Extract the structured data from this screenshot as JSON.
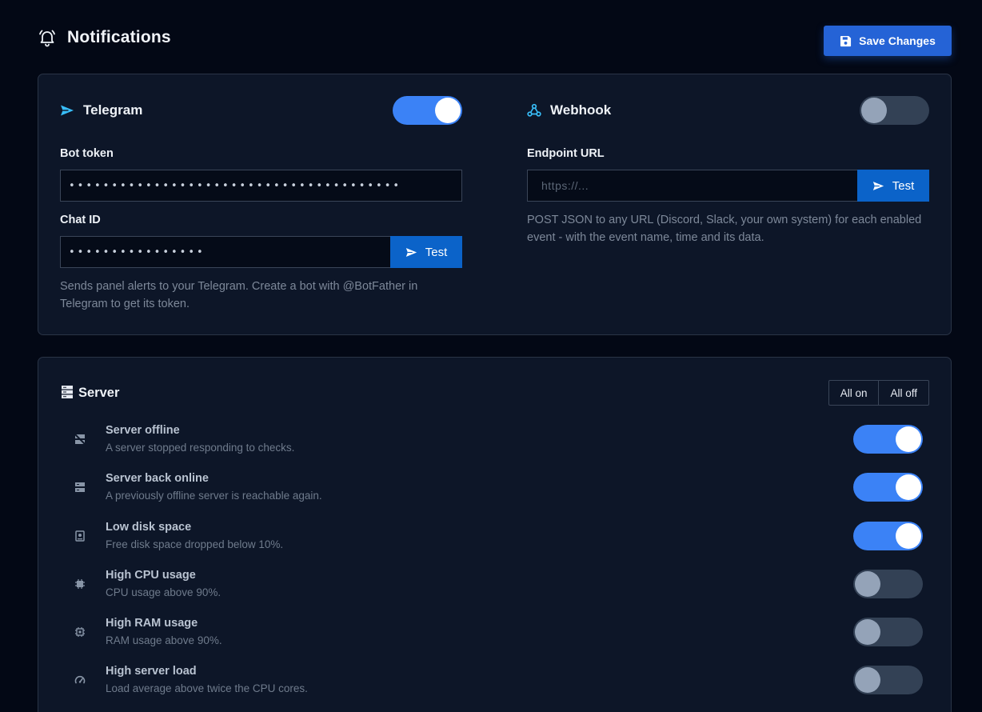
{
  "header": {
    "title": "Notifications",
    "title_icon": "bell-icon",
    "save_label": "Save Changes",
    "save_icon": "floppy-disk-icon"
  },
  "channels": {
    "telegram": {
      "name": "Telegram",
      "icon": "paper-plane-icon",
      "enabled": true,
      "bot_token_label": "Bot token",
      "bot_token_value": "•••••••••••••••••••••••••••••••••••••••",
      "chat_id_label": "Chat ID",
      "chat_id_value": "••••••••••••••••",
      "test_label": "Test",
      "help": "Sends panel alerts to your Telegram. Create a bot with @BotFather in Telegram to get its token."
    },
    "webhook": {
      "name": "Webhook",
      "icon": "webhook-icon",
      "enabled": false,
      "endpoint_label": "Endpoint URL",
      "endpoint_placeholder": "https://...",
      "test_label": "Test",
      "help": "POST JSON to any URL (Discord, Slack, your own system) for each enabled event - with the event name, time and its data."
    }
  },
  "server": {
    "title": "Server",
    "icon": "server-icon",
    "all_on": "All on",
    "all_off": "All off",
    "events": [
      {
        "name": "Server offline",
        "desc": "A server stopped responding to checks.",
        "icon": "server-off-icon",
        "enabled": true
      },
      {
        "name": "Server back online",
        "desc": "A previously offline server is reachable again.",
        "icon": "server-icon",
        "enabled": true
      },
      {
        "name": "Low disk space",
        "desc": "Free disk space dropped below 10%.",
        "icon": "hard-drive-icon",
        "enabled": true
      },
      {
        "name": "High CPU usage",
        "desc": "CPU usage above 90%.",
        "icon": "cpu-icon",
        "enabled": false
      },
      {
        "name": "High RAM usage",
        "desc": "RAM usage above 90%.",
        "icon": "memory-chip-icon",
        "enabled": false
      },
      {
        "name": "High server load",
        "desc": "Load average above twice the CPU cores.",
        "icon": "gauge-icon",
        "enabled": false
      }
    ]
  },
  "colors": {
    "background": "#030815",
    "card": "#0d1628",
    "accent": "#3b82f6",
    "button": "#0b63c9",
    "channel_icon": "#38bdf8"
  }
}
